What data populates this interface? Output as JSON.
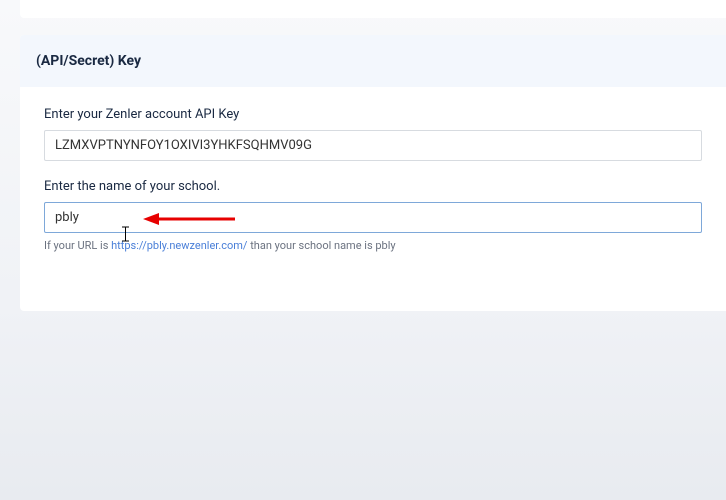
{
  "section": {
    "title": "(API/Secret) Key"
  },
  "fields": {
    "api_key": {
      "label": "Enter your Zenler account API Key",
      "value": "LZMXVPTNYNFOY1OXIVI3YHKFSQHMV09G"
    },
    "school_name": {
      "label": "Enter the name of your school.",
      "value": "pbly",
      "helper_prefix": "If your URL is ",
      "helper_link": "https://pbly.newzenler.com/",
      "helper_suffix": " than your school name is pbly"
    }
  }
}
